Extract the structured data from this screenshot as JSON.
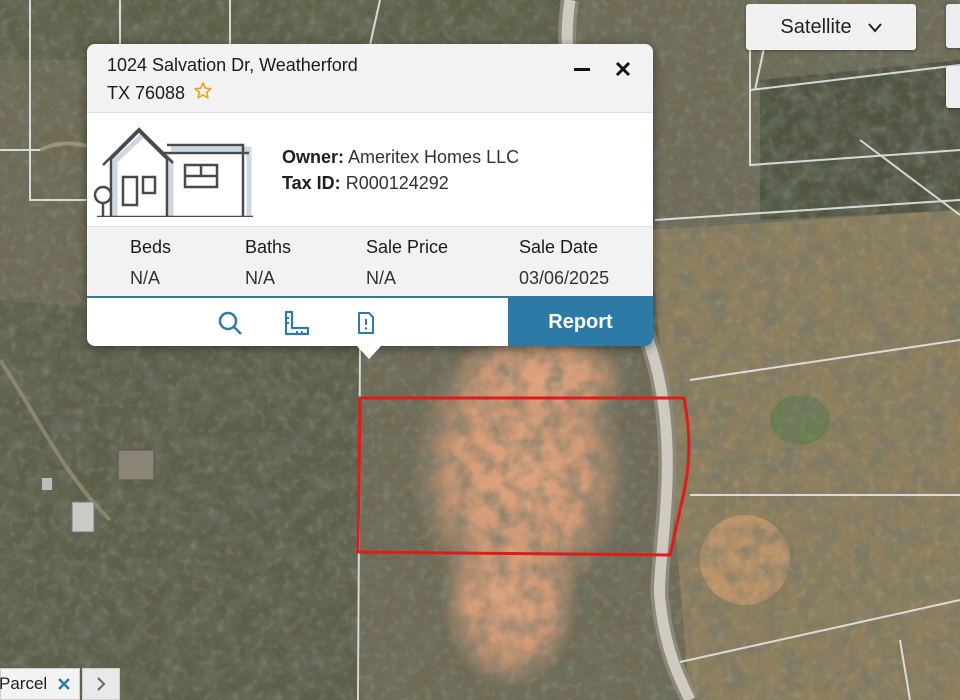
{
  "map": {
    "layer_label": "Satellite",
    "icons": {
      "layer_dropdown": "chevron-down-icon",
      "selected_parcel": "parcel-outline",
      "favorite": "star-icon"
    },
    "colors": {
      "parcel_outline": "#e01b1b",
      "parcel_lines": "#e4e4e4",
      "road": "#c9c4b8",
      "vegetation": "#3d4233",
      "bare_soil": "#d69a73"
    }
  },
  "popup": {
    "address_line1": "1024 Salvation Dr, Weatherford",
    "address_line2": "TX 76088",
    "owner_label": "Owner:",
    "owner_value": "Ameritex Homes LLC",
    "tax_label": "Tax ID:",
    "tax_value": "R000124292",
    "stats": [
      {
        "label": "Beds",
        "value": "N/A"
      },
      {
        "label": "Baths",
        "value": "N/A"
      },
      {
        "label": "Sale Price",
        "value": "N/A"
      },
      {
        "label": "Sale Date",
        "value": "03/06/2025"
      }
    ],
    "report_label": "Report",
    "accent": "#2d7aa6",
    "icons": [
      "minimize-icon",
      "close-icon",
      "search-icon",
      "ruler-icon",
      "document-icon"
    ]
  },
  "bottom_bar": {
    "chip_label": "Parcel",
    "chip_icon": "close-icon",
    "next_icon": "chevron-right-icon"
  }
}
